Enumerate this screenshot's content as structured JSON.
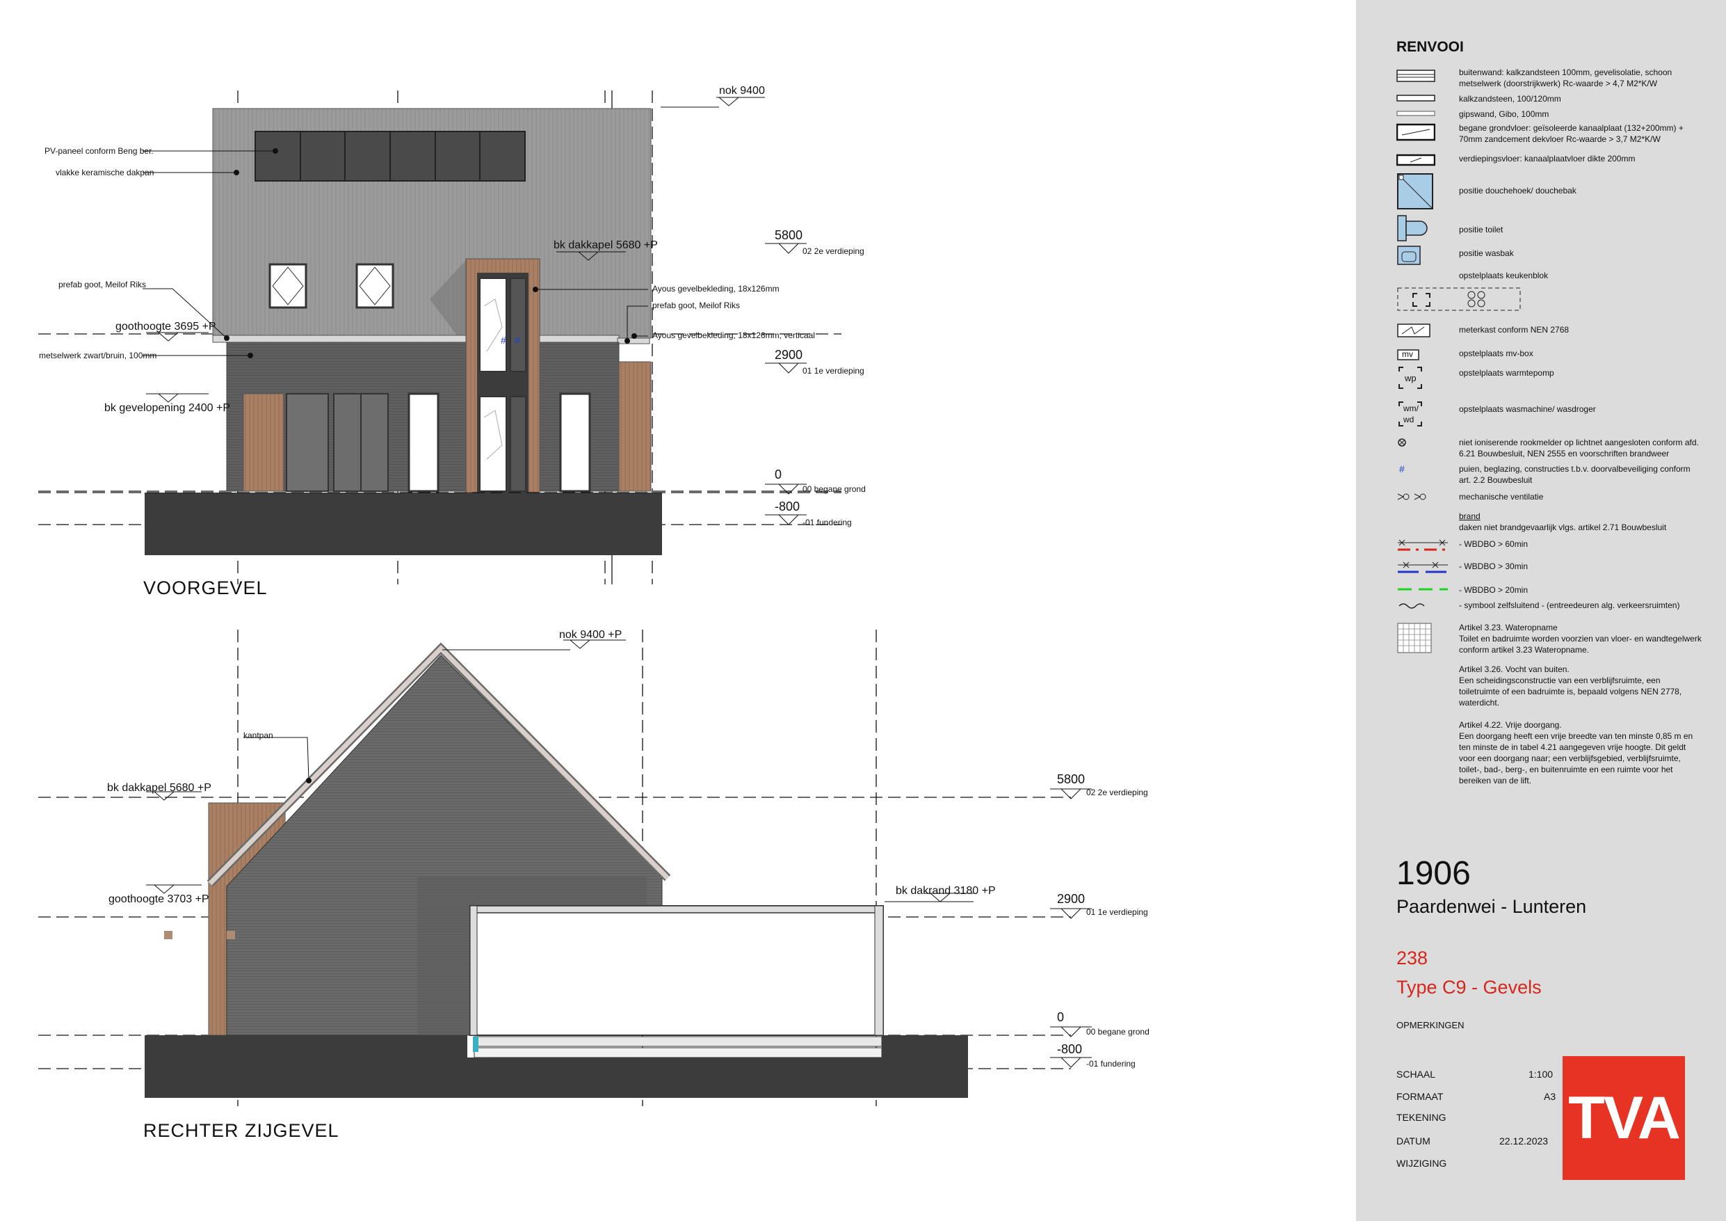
{
  "elevations": {
    "front": {
      "title": "VOORGEVEL",
      "nok": "nok 9400",
      "dakkapel": "bk dakkapel 5680 +P",
      "goothoogte": "goothoogte 3695 +P",
      "gevelopening": "bk gevelopening 2400 +P",
      "levels": [
        {
          "value": "5800",
          "label": "02 2e verdieping"
        },
        {
          "value": "2900",
          "label": "01 1e verdieping"
        },
        {
          "value": "0",
          "label": "00 begane grond"
        },
        {
          "value": "-800",
          "label": "-01 fundering"
        }
      ],
      "notes": [
        "PV-paneel conform Beng ber.",
        "vlakke keramische dakpan",
        "prefab goot, Meilof Riks",
        "metselwerk zwart/bruin, 100mm",
        "Ayous gevelbekleding, 18x126mm",
        "prefab goot, Meilof Riks",
        "Ayous gevelbekleding, 18x126mm, verticaal"
      ]
    },
    "side": {
      "title": "RECHTER ZIJGEVEL",
      "nok": "nok 9400 +P",
      "kantpan": "kantpan",
      "dakkapel": "bk dakkapel 5680 +P",
      "goothoogte": "goothoogte 3703 +P",
      "dakrand": "bk dakrand 3180 +P",
      "levels": [
        {
          "value": "5800",
          "label": "02 2e verdieping"
        },
        {
          "value": "2900",
          "label": "01 1e verdieping"
        },
        {
          "value": "0",
          "label": "00 begane grond"
        },
        {
          "value": "-800",
          "label": "-01 fundering"
        }
      ]
    }
  },
  "legend": {
    "title": "RENVOOI",
    "items": [
      "buitenwand: kalkzandsteen 100mm, gevelisolatie, schoon metselwerk (doorstrijkwerk) Rc-waarde > 4,7 M2*K/W",
      "kalkzandsteen, 100/120mm",
      "gipswand, Gibo, 100mm",
      "begane grondvloer: geïsoleerde kanaalplaat (132+200mm) + 70mm zandcement dekvloer Rc-waarde > 3,7 M2*K/W",
      "verdiepingsvloer: kanaalplaatvloer dikte 200mm",
      "positie douchehoek/ douchebak",
      "positie toilet",
      "positie wasbak",
      "opstelplaats keukenblok",
      "meterkast conform NEN 2768",
      "opstelplaats mv-box",
      "opstelplaats warmtepomp",
      "opstelplaats wasmachine/ wasdroger",
      "niet ioniserende rookmelder op lichtnet aangesloten conform afd. 6.21 Bouwbesluit, NEN 2555 en voorschriften brandweer",
      "puien, beglazing, constructies t.b.v. doorvalbeveiliging conform art. 2.2 Bouwbesluit",
      "mechanische ventilatie"
    ],
    "brand_head": "brand",
    "brand_text": "daken niet brandgevaarlijk vlgs. artikel 2.71 Bouwbesluit",
    "wbdbo": [
      "- WBDBO > 60min",
      "- WBDBO > 30min",
      "- WBDBO > 20min",
      "- symbool zelfsluitend - (entreedeuren alg. verkeersruimten)"
    ],
    "articles": [
      "Artikel 3.23. Wateropname\nToilet en badruimte worden voorzien van vloer- en wandtegelwerk conform artikel 3.23 Wateropname.",
      "Artikel 3.26. Vocht van buiten.\nEen scheidingsconstructie van een verblijfsruimte, een toiletruimte of een badruimte is, bepaald volgens NEN 2778, waterdicht.",
      "Artikel 4.22. Vrije doorgang.\nEen doorgang heeft een vrije breedte van ten minste 0,85 m en ten minste de in tabel 4.21 aangegeven vrije hoogte. Dit geldt voor een doorgang naar; een verblijfsgebied, verblijfsruimte, toilet-, bad-, berg-, en buitenruimte en een ruimte voor het bereiken van de lift."
    ],
    "symbols": {
      "wp": "wp",
      "wm": "wm/",
      "wd": "wd",
      "mv": "mv",
      "hash": "#"
    }
  },
  "titleblock": {
    "project_number": "1906",
    "project_name": "Paardenwei - Lunteren",
    "code": "238",
    "type": "Type C9 - Gevels",
    "opmerkingen": "OPMERKINGEN",
    "schaal_label": "SCHAAL",
    "schaal": "1:100",
    "formaat_label": "FORMAAT",
    "formaat": "A3",
    "tekening_label": "TEKENING",
    "datum_label": "DATUM",
    "datum": "22.12.2023",
    "wijziging_label": "WIJZIGING",
    "logo": "TVA"
  },
  "colors": {
    "accent": "#e63323",
    "red_text": "#d6261c",
    "panel": "#dcdcdc",
    "roof": "#9a9a9a",
    "brick": "#5e5e5e",
    "ground": "#3c3c3c",
    "wood": "#a98063"
  }
}
